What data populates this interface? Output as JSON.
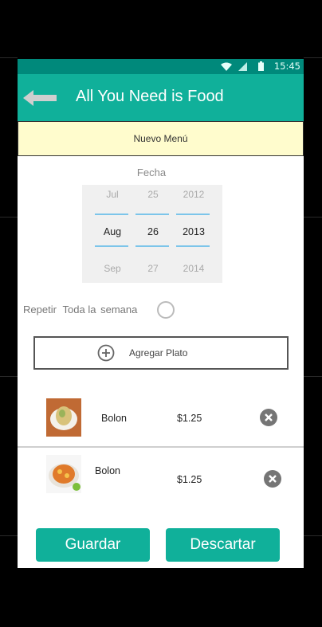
{
  "status": {
    "time": "15:45"
  },
  "appbar": {
    "title": "All You Need is Food"
  },
  "banner": {
    "label": "Nuevo Menú"
  },
  "date": {
    "label": "Fecha",
    "month": {
      "prev": "Jul",
      "selected": "Aug",
      "next": "Sep"
    },
    "day": {
      "prev": "25",
      "selected": "26",
      "next": "27"
    },
    "year": {
      "prev": "2012",
      "selected": "2013",
      "next": "2014"
    }
  },
  "repeat": {
    "word1": "Repetir",
    "word2": "Toda la",
    "word3": "semana"
  },
  "add_dish": {
    "label": "Agregar Plato"
  },
  "dishes": [
    {
      "name": "Bolon",
      "price": "$1.25"
    },
    {
      "name": "Bolon",
      "price": "$1.25"
    }
  ],
  "actions": {
    "save": "Guardar",
    "discard": "Descartar"
  },
  "colors": {
    "accent": "#10b09a",
    "statusbar": "#00897b",
    "banner": "#fffccd"
  }
}
